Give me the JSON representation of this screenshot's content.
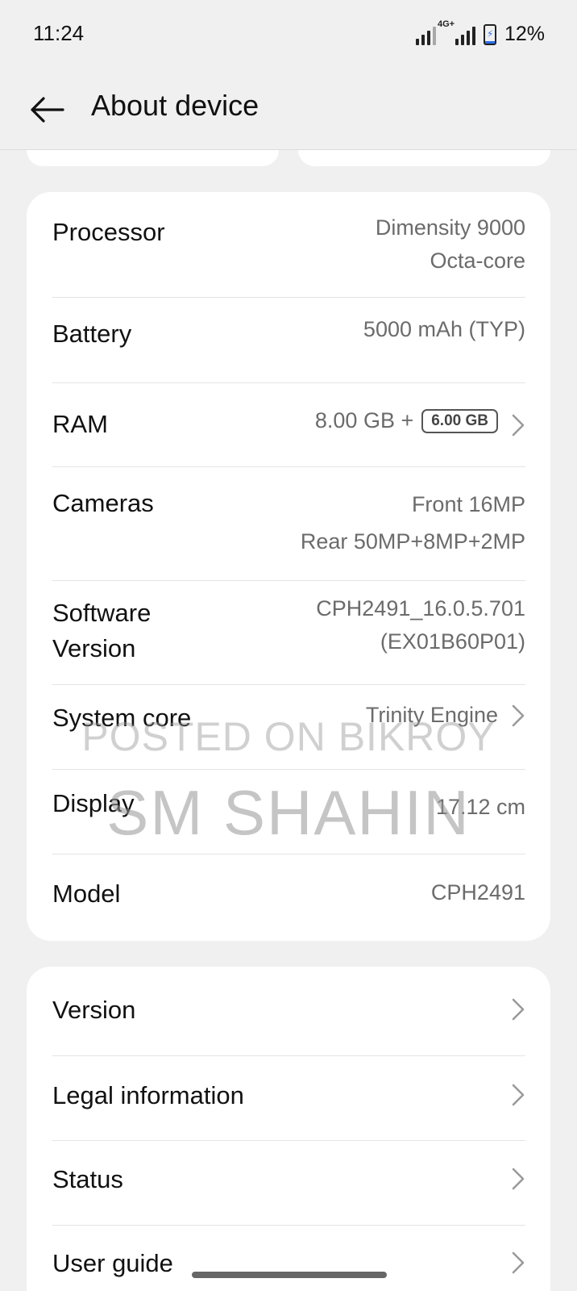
{
  "status_bar": {
    "time": "11:24",
    "network_label": "4G+",
    "battery_percent": "12%",
    "battery_level": 0.12
  },
  "header": {
    "title": "About device"
  },
  "specs": [
    {
      "label": "Processor",
      "value_lines": [
        "Dimensity 9000",
        "Octa-core"
      ]
    },
    {
      "label": "Battery",
      "value_lines": [
        "5000 mAh (TYP)"
      ]
    },
    {
      "label": "RAM",
      "value": "8.00 GB +",
      "badge": "6.00 GB"
    },
    {
      "label": "Cameras",
      "value_lines": [
        "Front 16MP",
        "Rear 50MP+8MP+2MP"
      ]
    },
    {
      "label_lines": [
        "Software",
        "Version"
      ],
      "value_lines": [
        "CPH2491_16.0.5.701",
        "(EX01B60P01)"
      ]
    },
    {
      "label": "System core",
      "value": "Trinity Engine"
    },
    {
      "label": "Display",
      "value": "17.12 cm"
    },
    {
      "label": "Model",
      "value": "CPH2491"
    }
  ],
  "menu": [
    {
      "label": "Version"
    },
    {
      "label": "Legal information"
    },
    {
      "label": "Status"
    },
    {
      "label": "User guide"
    }
  ],
  "watermark": {
    "line1": "POSTED ON BIKROY",
    "line2": "SM SHAHIN"
  },
  "icons": {
    "back": "arrow-left-icon",
    "chevron": "chevron-right-icon",
    "signal": "signal-icon",
    "battery": "battery-icon"
  },
  "colors": {
    "background": "#f0f0f0",
    "card": "#ffffff",
    "battery_fill": "#2a6ff3",
    "secondary_text": "#6b6b6b"
  }
}
